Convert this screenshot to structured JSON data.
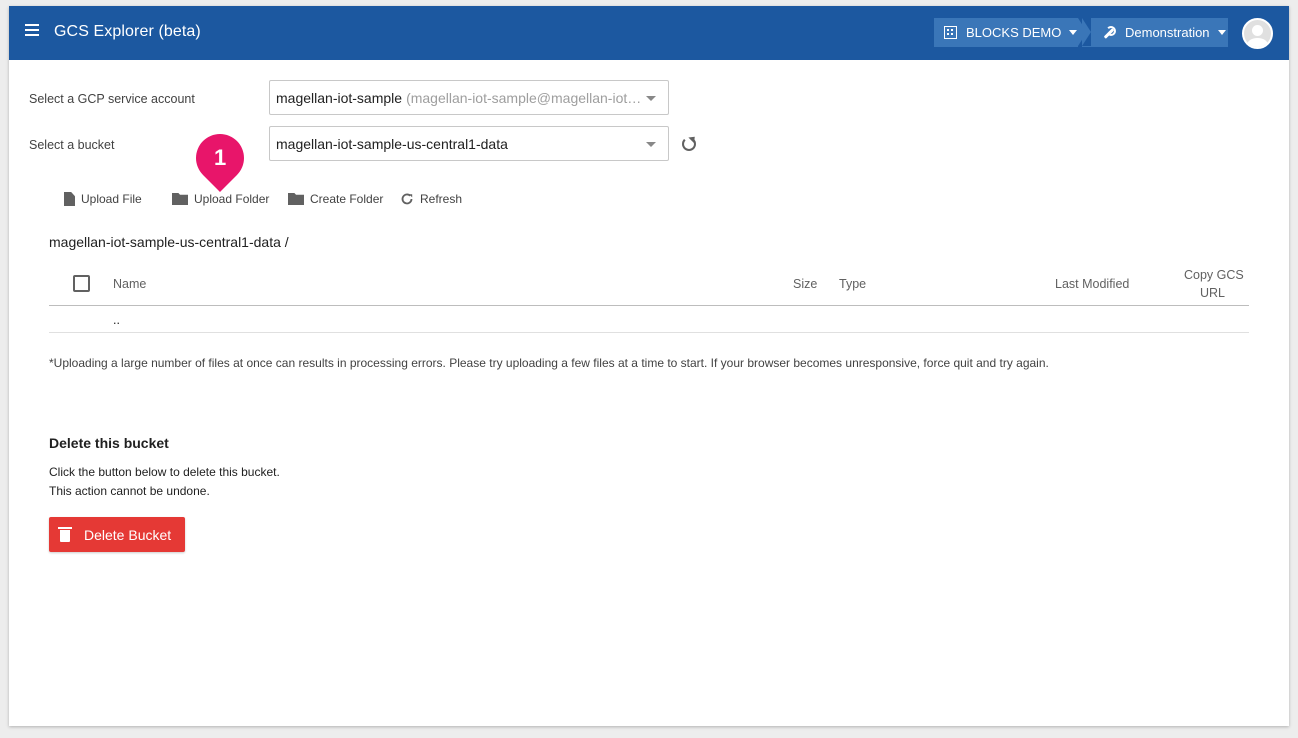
{
  "appbar": {
    "title": "GCS Explorer (beta)",
    "organization": "BLOCKS DEMO",
    "project": "Demonstration"
  },
  "form": {
    "service_account_label": "Select a GCP service account",
    "service_account_value": "magellan-iot-sample",
    "service_account_detail": "(magellan-iot-sample@magellan-iot…",
    "bucket_label": "Select a bucket",
    "bucket_value": "magellan-iot-sample-us-central1-data"
  },
  "toolbar": {
    "upload_file": "Upload File",
    "upload_folder": "Upload Folder",
    "create_folder": "Create Folder",
    "refresh": "Refresh"
  },
  "path": "magellan-iot-sample-us-central1-data /",
  "table": {
    "columns": [
      "Name",
      "Size",
      "Type",
      "Last Modified",
      "Copy GCS",
      "URL"
    ],
    "rows": [
      ".."
    ]
  },
  "note": "*Uploading a large number of files at once can results in processing errors. Please try uploading a few files at a time to start. If your browser becomes unresponsive, force quit and try again.",
  "delete": {
    "title": "Delete this bucket",
    "line1": "Click the button below to delete this bucket.",
    "line2": "This action cannot be undone.",
    "button": "Delete Bucket"
  },
  "annotation": {
    "marker_number": "1",
    "marker_color": "#e8156a"
  },
  "colors": {
    "appbar": "#1c58a0",
    "breadcrumb": "#3a76b8",
    "danger": "#e53935"
  }
}
